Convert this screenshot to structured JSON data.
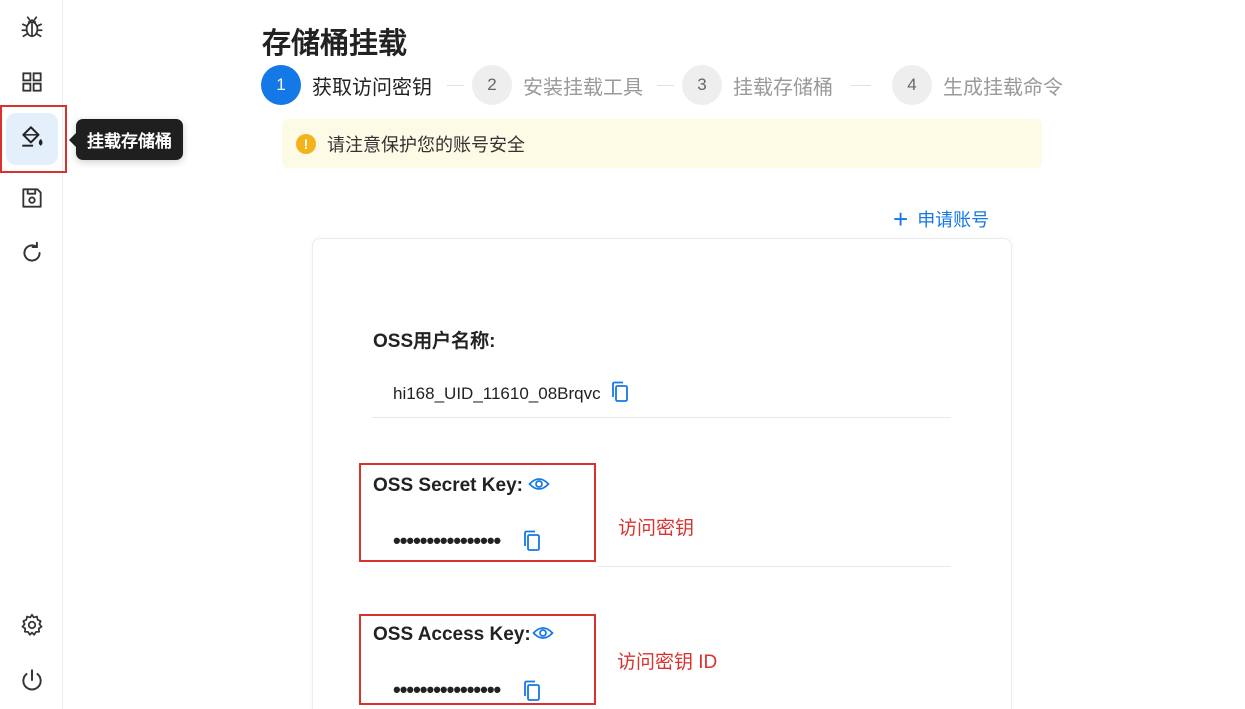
{
  "sidebar": {
    "items": [
      {
        "icon": "bug-icon"
      },
      {
        "icon": "grid-icon"
      },
      {
        "icon": "paint-bucket-icon",
        "active": true
      },
      {
        "icon": "save-icon"
      },
      {
        "icon": "refresh-icon"
      },
      {
        "icon": "gear-icon"
      },
      {
        "icon": "power-icon"
      }
    ],
    "tooltip": "挂载存储桶"
  },
  "page": {
    "title": "存储桶挂载"
  },
  "steps": [
    {
      "number": "1",
      "label": "获取访问密钥",
      "active": true
    },
    {
      "number": "2",
      "label": "安装挂载工具",
      "active": false
    },
    {
      "number": "3",
      "label": "挂载存储桶",
      "active": false
    },
    {
      "number": "4",
      "label": "生成挂载命令",
      "active": false
    }
  ],
  "alert": {
    "icon": "!",
    "text": "请注意保护您的账号安全"
  },
  "apply_account": {
    "icon": "+",
    "label": "申请账号"
  },
  "fields": {
    "username": {
      "label": "OSS用户名称:",
      "value": "hi168_UID_11610_08Brqvc"
    },
    "secret_key": {
      "label": "OSS Secret Key:",
      "value": "••••••••••••••••",
      "annotation": "访问密钥"
    },
    "access_key": {
      "label": "OSS Access Key:",
      "value": "••••••••••••••••",
      "annotation": "访问密钥 ID"
    }
  },
  "colors": {
    "primary": "#1478e6",
    "highlight_red": "#d9322e",
    "alert_bg": "#fdfae5",
    "alert_icon": "#f3b31b"
  }
}
